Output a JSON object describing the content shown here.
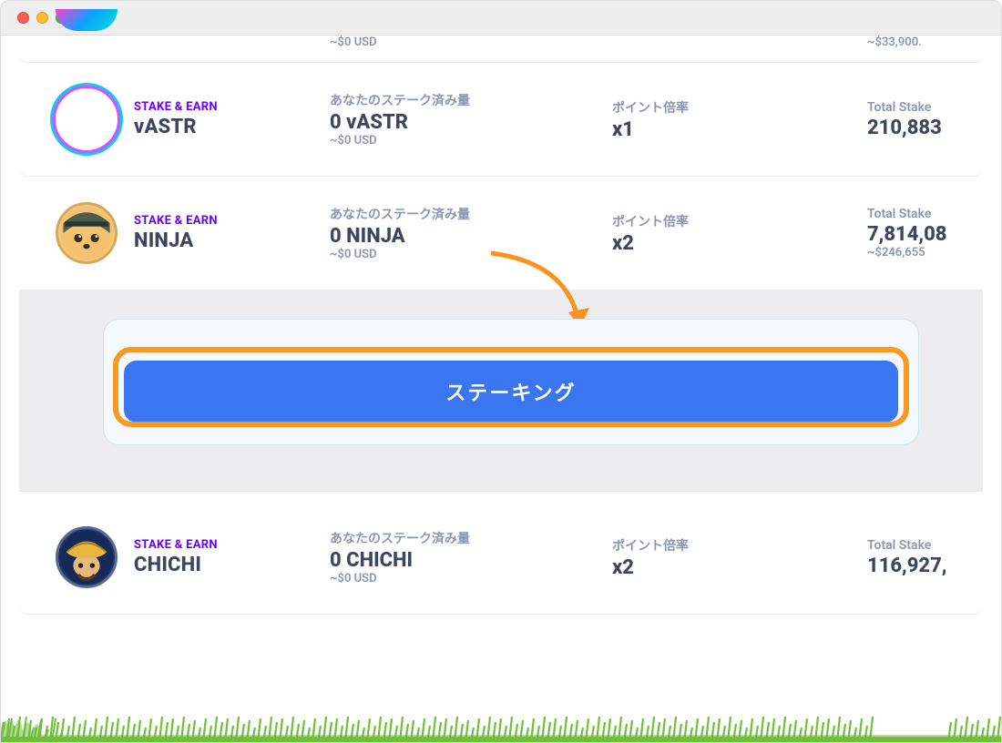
{
  "badge": "STAKE & EARN",
  "labels": {
    "staked": "あなたのステーク済み量",
    "multiplier": "ポイント倍率",
    "total": "Total Stake"
  },
  "rows": [
    {
      "name": "vASTR",
      "staked_value": "0 vASTR",
      "staked_usd": "~$0 USD",
      "multiplier": "x1",
      "total": "210,883",
      "total_usd": ""
    },
    {
      "name": "NINJA",
      "staked_value": "0 NINJA",
      "staked_usd": "~$0 USD",
      "multiplier": "x2",
      "total": "7,814,08",
      "total_usd": "~$246,655"
    },
    {
      "name": "CHICHI",
      "staked_value": "0 CHICHI",
      "staked_usd": "~$0 USD",
      "multiplier": "x2",
      "total": "116,927,",
      "total_usd": ""
    }
  ],
  "cta_button": "ステーキング",
  "top_cut_usd": "~$0 USD",
  "top_right_cut": "~$33,900."
}
